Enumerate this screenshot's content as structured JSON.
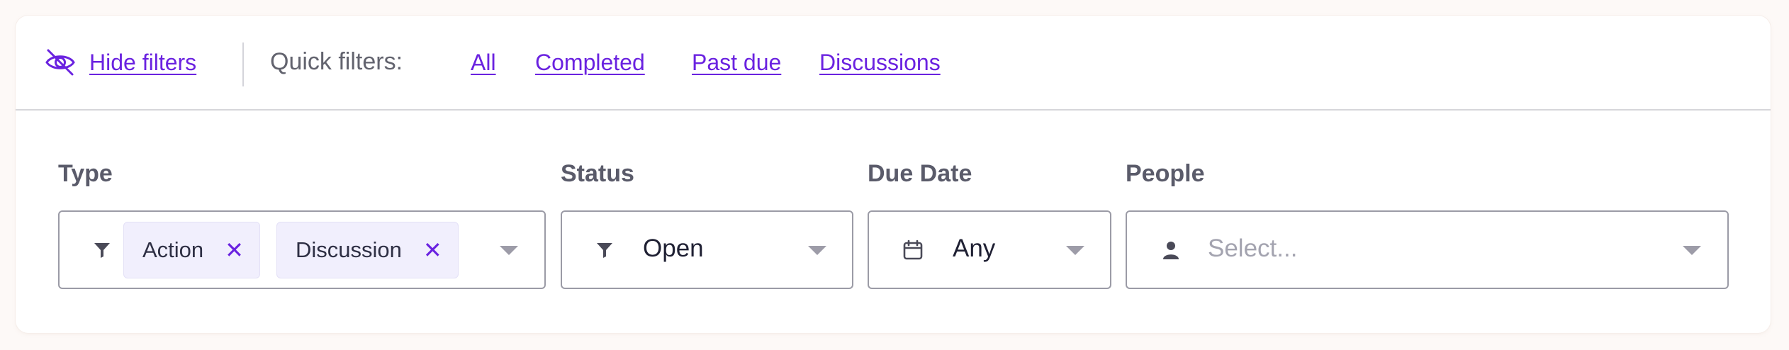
{
  "topbar": {
    "hide_filters_label": "Hide filters",
    "hide_filters_icon": "eye-slash-icon",
    "quick_filters_label": "Quick filters:",
    "quick_filters": [
      "All",
      "Completed",
      "Past due",
      "Discussions"
    ]
  },
  "filters": {
    "type": {
      "label": "Type",
      "icon": "funnel-icon",
      "chips": [
        "Action",
        "Discussion"
      ],
      "remove_glyph": "✕"
    },
    "status": {
      "label": "Status",
      "icon": "funnel-icon",
      "value": "Open"
    },
    "due_date": {
      "label": "Due Date",
      "icon": "calendar-icon",
      "value": "Any"
    },
    "people": {
      "label": "People",
      "icon": "person-icon",
      "placeholder": "Select..."
    }
  },
  "colors": {
    "accent": "#6a22e0",
    "chip_bg": "#f1effd",
    "label": "#5a5b6a",
    "border": "#9b9ba6"
  }
}
